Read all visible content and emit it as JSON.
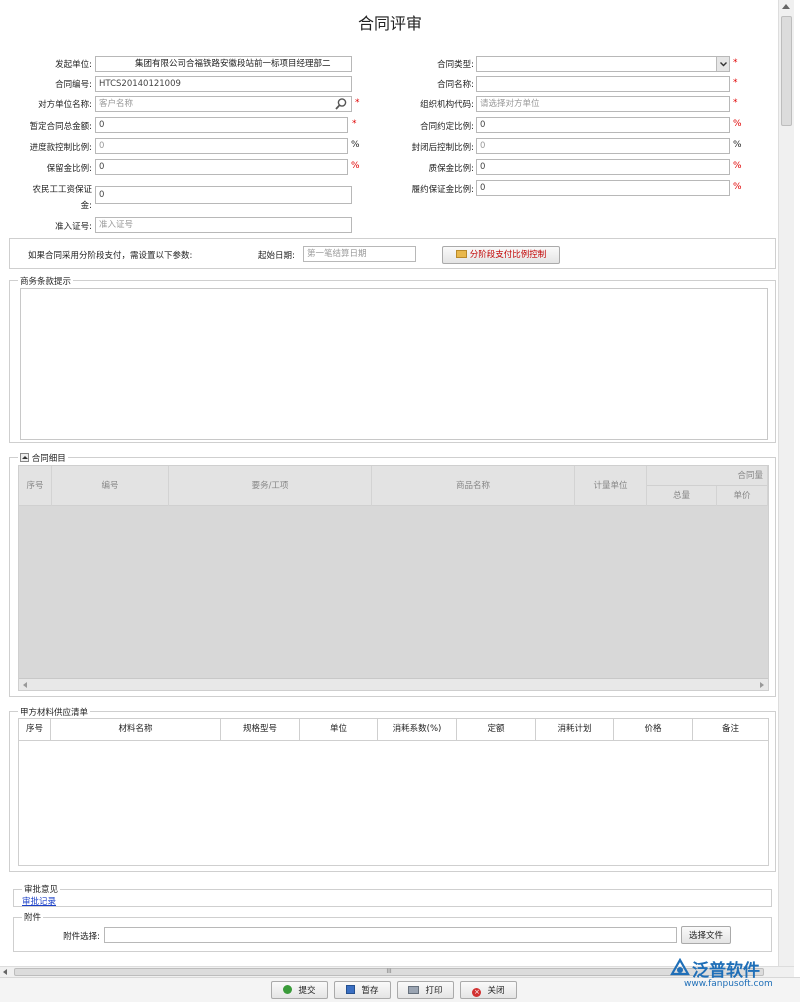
{
  "page": {
    "title": "合同评审"
  },
  "form": {
    "initiator": {
      "label": "发起单位:",
      "value": "集团有限公司合福铁路安徽段站前一标项目经理部二"
    },
    "contract_no": {
      "label": "合同编号:",
      "value": "HTCS20140121009"
    },
    "counterparty": {
      "label": "对方单位名称:",
      "placeholder": "客户名称"
    },
    "total_amount": {
      "label": "暂定合同总金额:",
      "value": "0"
    },
    "progress_ratio": {
      "label": "进度款控制比例:",
      "value": "0",
      "unit": "%"
    },
    "retention_ratio": {
      "label": "保留金比例:",
      "value": "0",
      "unit": "%"
    },
    "wage_deposit": {
      "label1": "农民工工资保证",
      "label2": "金:",
      "value": "0"
    },
    "access_no": {
      "label": "准入证号:",
      "placeholder": "准入证号"
    },
    "contract_type": {
      "label": "合同类型:",
      "value": ""
    },
    "contract_name": {
      "label": "合同名称:",
      "value": ""
    },
    "org_code": {
      "label": "组织机构代码:",
      "placeholder": "请选择对方单位"
    },
    "agreed_ratio": {
      "label": "合同约定比例:",
      "value": "0",
      "unit": "%"
    },
    "post_close_ratio": {
      "label": "封闭后控制比例:",
      "value": "0",
      "unit": "%"
    },
    "warranty_ratio": {
      "label": "质保金比例:",
      "value": "0",
      "unit": "%"
    },
    "performance_ratio": {
      "label": "履约保证金比例:",
      "value": "0",
      "unit": "%"
    },
    "required_mark": "*"
  },
  "staged": {
    "note": "如果合同采用分阶段支付，需设置以下参数:",
    "start_label": "起始日期:",
    "start_placeholder": "第一笔结算日期",
    "button": "分阶段支付比例控制"
  },
  "business_terms": {
    "legend": "商务条款提示"
  },
  "contract_items": {
    "legend": "合同细目",
    "columns": [
      "序号",
      "编号",
      "要务/工项",
      "商品名称",
      "计量单位",
      "合同量"
    ],
    "subcolumns": [
      "总量",
      "单价"
    ]
  },
  "materials": {
    "legend": "甲方材料供应清单",
    "columns": [
      "序号",
      "材料名称",
      "规格型号",
      "单位",
      "消耗系数(%)",
      "定额",
      "消耗计划",
      "价格",
      "备注"
    ]
  },
  "approval": {
    "legend": "审批意见",
    "link": "审批记录"
  },
  "attachment": {
    "legend": "附件",
    "label": "附件选择:",
    "button": "选择文件"
  },
  "toolbar": {
    "submit": "提交",
    "save": "暂存",
    "print": "打印",
    "close": "关闭"
  },
  "watermark": {
    "name": "泛普软件",
    "url": "www.fanpusoft.com"
  },
  "scrollbar": {
    "center": "III"
  }
}
